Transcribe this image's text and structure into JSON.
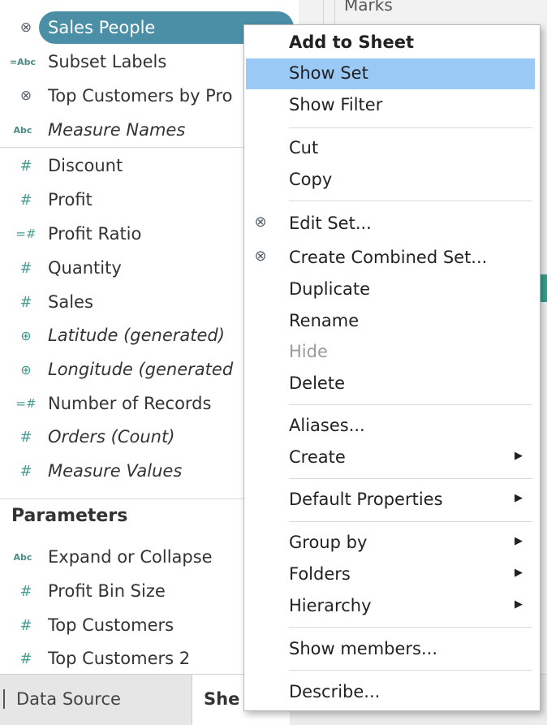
{
  "data_pane": {
    "dimensions": [
      {
        "icon": "set-icon",
        "glyph": "⊗",
        "label": "Sales People",
        "italic": false,
        "selected": true
      },
      {
        "icon": "abc-icon",
        "glyph": "=Abc",
        "label": "Subset Labels",
        "italic": false
      },
      {
        "icon": "set-icon",
        "glyph": "⊗",
        "label": "Top Customers by Pro",
        "italic": false
      },
      {
        "icon": "abc-icon",
        "glyph": "Abc",
        "label": "Measure Names",
        "italic": true
      }
    ],
    "measures": [
      {
        "icon": "hash-icon",
        "glyph": "#",
        "label": "Discount",
        "italic": false
      },
      {
        "icon": "hash-icon",
        "glyph": "#",
        "label": "Profit",
        "italic": false
      },
      {
        "icon": "calc-hash-icon",
        "glyph": "=#",
        "label": "Profit Ratio",
        "italic": false
      },
      {
        "icon": "hash-icon",
        "glyph": "#",
        "label": "Quantity",
        "italic": false
      },
      {
        "icon": "hash-icon",
        "glyph": "#",
        "label": "Sales",
        "italic": false
      },
      {
        "icon": "globe-icon",
        "glyph": "⊕",
        "label": "Latitude (generated)",
        "italic": true
      },
      {
        "icon": "globe-icon",
        "glyph": "⊕",
        "label": "Longitude (generated",
        "italic": true
      },
      {
        "icon": "calc-hash-icon",
        "glyph": "=#",
        "label": "Number of Records",
        "italic": false
      },
      {
        "icon": "hash-icon",
        "glyph": "#",
        "label": "Orders (Count)",
        "italic": true
      },
      {
        "icon": "hash-icon",
        "glyph": "#",
        "label": "Measure Values",
        "italic": true
      }
    ],
    "parameters_heading": "Parameters",
    "parameters": [
      {
        "icon": "abc-icon",
        "glyph": "Abc",
        "label": "Expand or Collapse",
        "italic": false
      },
      {
        "icon": "hash-icon",
        "glyph": "#",
        "label": "Profit Bin Size",
        "italic": false
      },
      {
        "icon": "hash-icon",
        "glyph": "#",
        "label": "Top Customers",
        "italic": false
      },
      {
        "icon": "hash-icon",
        "glyph": "#",
        "label": "Top Customers 2",
        "italic": false
      }
    ]
  },
  "marks_label": "Marks",
  "tabs": {
    "data_source": "Data Source",
    "sheet": "She"
  },
  "context_menu": {
    "items": {
      "add_to_sheet": "Add to Sheet",
      "show_set": "Show Set",
      "show_filter": "Show Filter",
      "cut": "Cut",
      "copy": "Copy",
      "edit_set": "Edit Set...",
      "create_combined_set": "Create Combined Set...",
      "duplicate": "Duplicate",
      "rename": "Rename",
      "hide": "Hide",
      "delete": "Delete",
      "aliases": "Aliases...",
      "create": "Create",
      "default_properties": "Default Properties",
      "group_by": "Group by",
      "folders": "Folders",
      "hierarchy": "Hierarchy",
      "show_members": "Show members...",
      "describe": "Describe..."
    },
    "highlighted_item": "Show Set",
    "disabled_item": "Hide",
    "highlight_color": "#99c9f4"
  },
  "colors": {
    "selected_pill": "#4a8fa6",
    "field_icon": "#3a8b86",
    "teal_chip": "#3aa08a"
  }
}
